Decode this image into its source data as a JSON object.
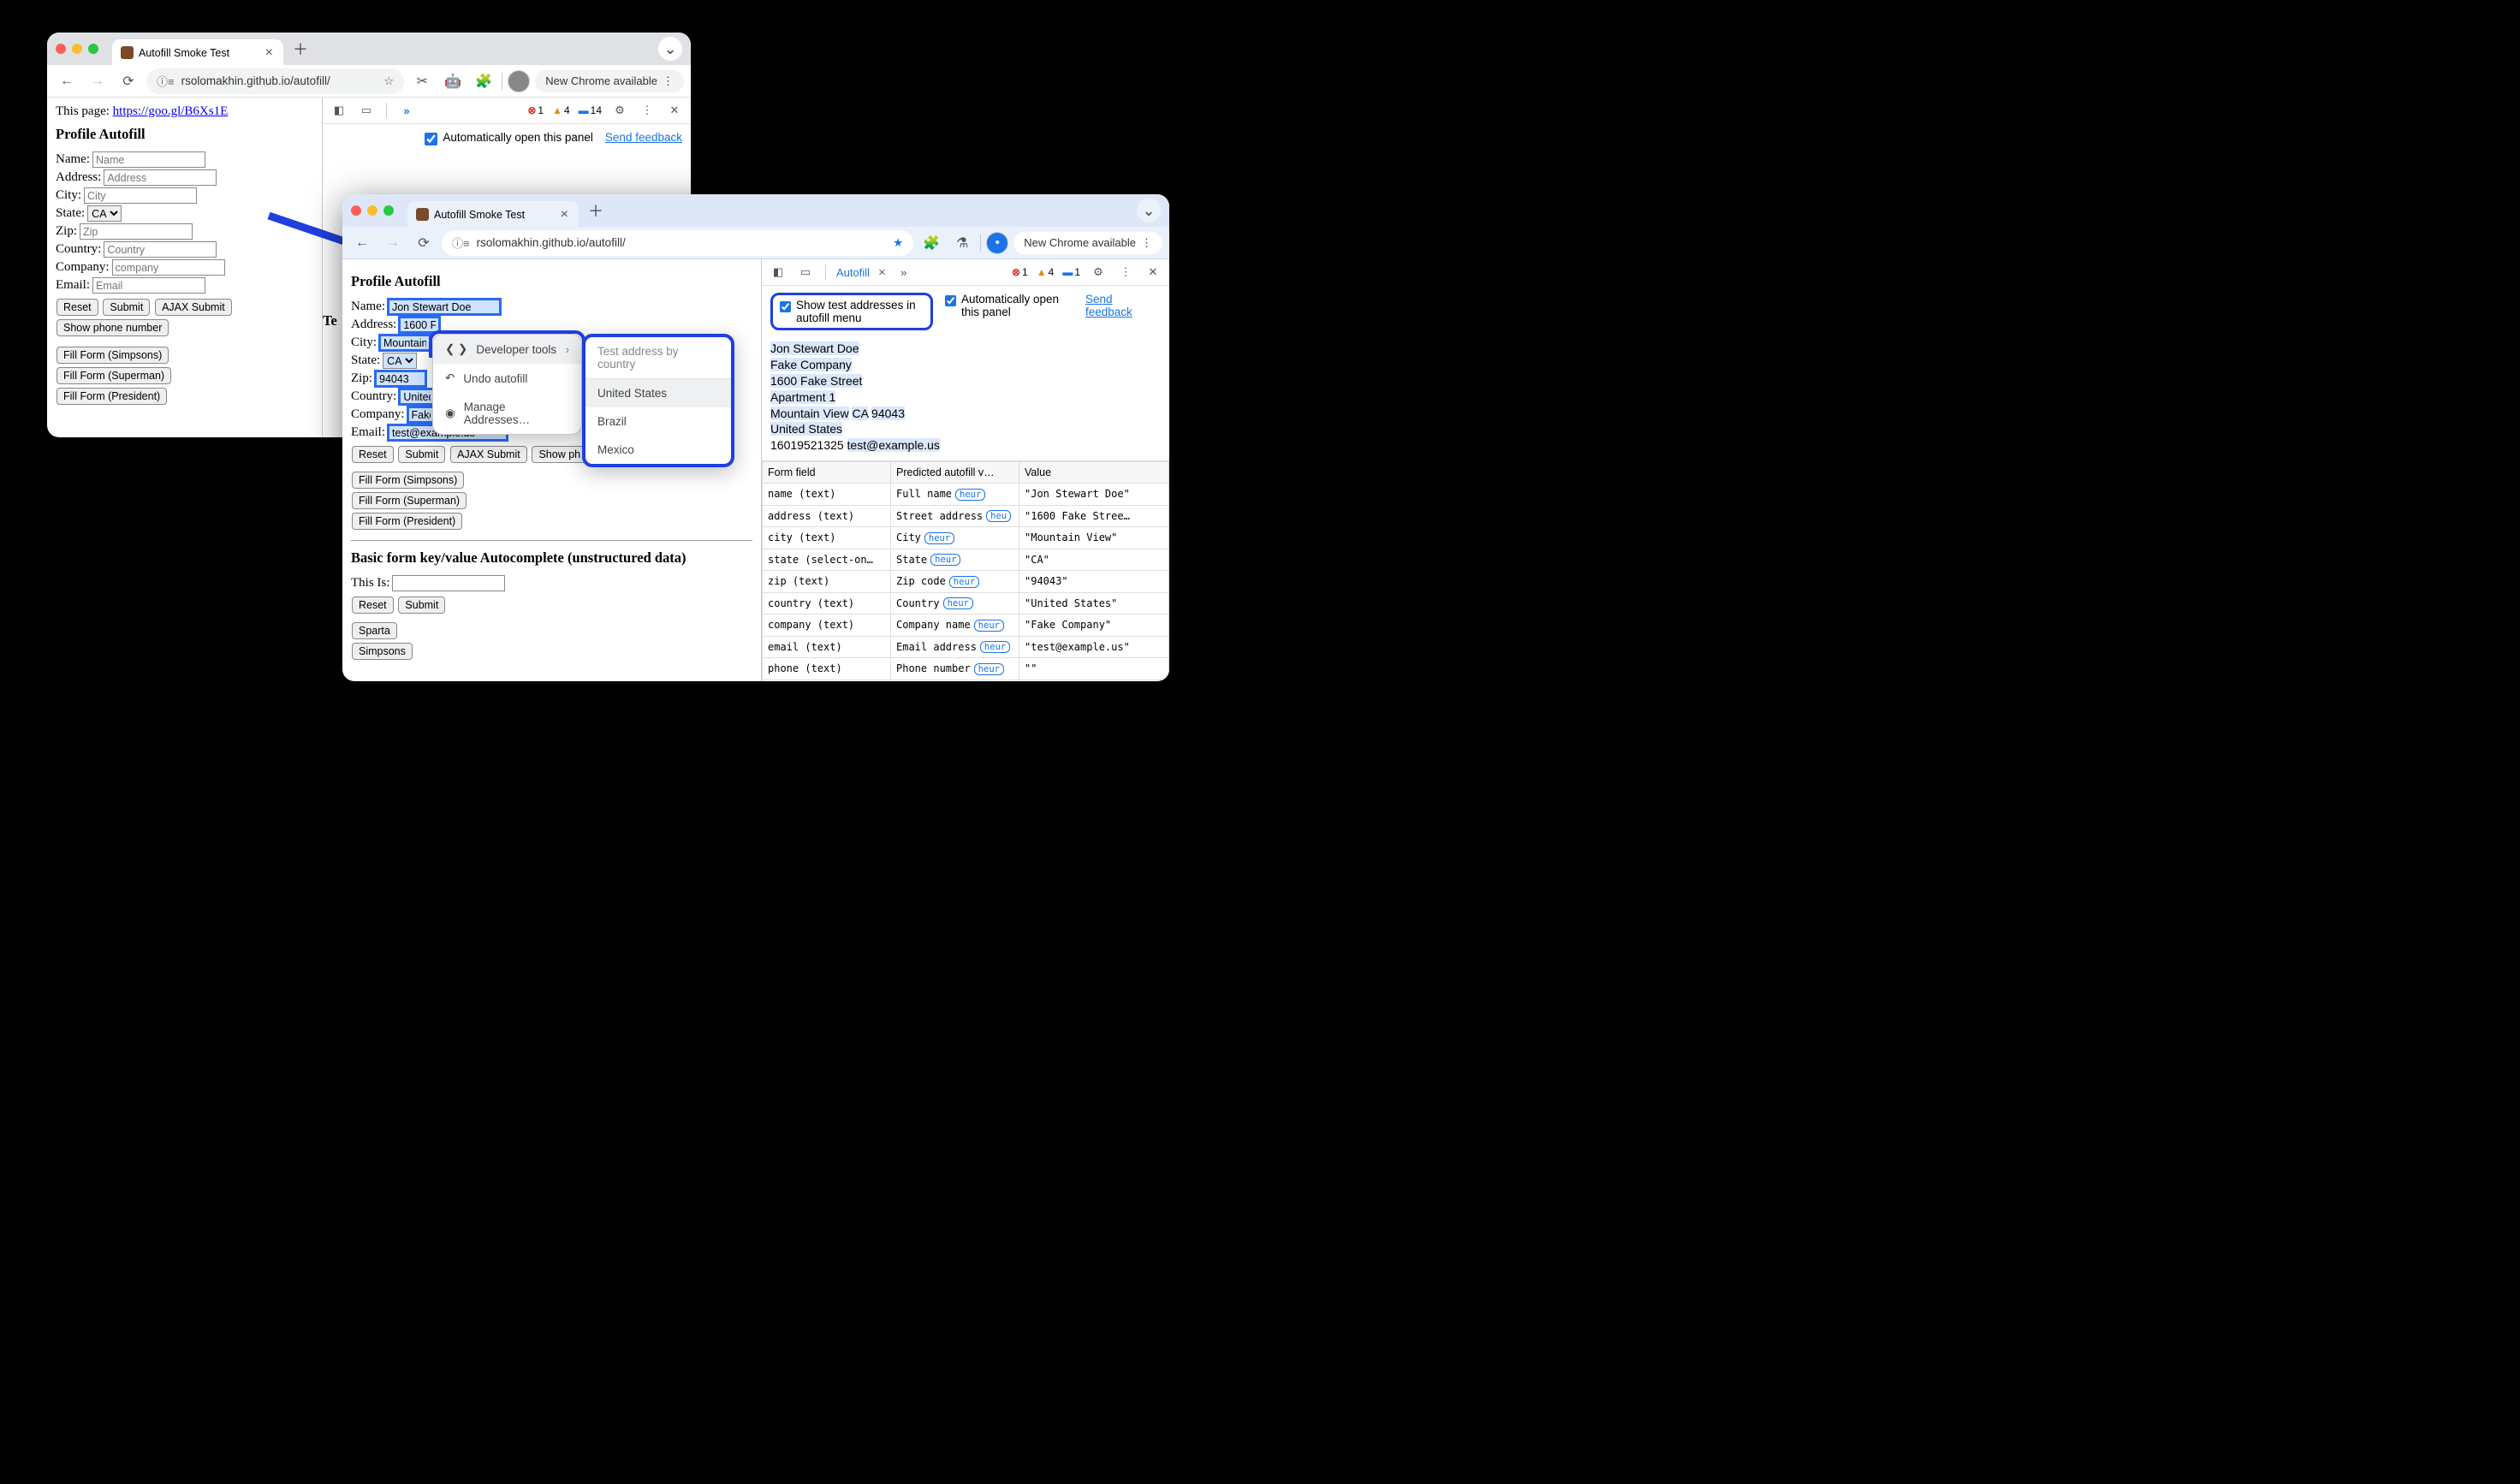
{
  "window1": {
    "tab_title": "Autofill Smoke Test",
    "url": "rsolomakhin.github.io/autofill/",
    "new_chrome": "New Chrome available",
    "page_prefix": "This page: ",
    "page_link": "https://goo.gl/B6Xs1E",
    "heading": "Profile Autofill",
    "labels": {
      "name": "Name:",
      "address": "Address:",
      "city": "City:",
      "state": "State:",
      "zip": "Zip:",
      "country": "Country:",
      "company": "Company:",
      "email": "Email:"
    },
    "placeholders": {
      "name": "Name",
      "address": "Address",
      "city": "City",
      "zip": "Zip",
      "country": "Country",
      "company": "company",
      "email": "Email"
    },
    "state_value": "CA",
    "buttons": {
      "reset": "Reset",
      "submit": "Submit",
      "ajax": "AJAX Submit",
      "show_phone": "Show phone number",
      "ff_simpsons": "Fill Form (Simpsons)",
      "ff_superman": "Fill Form (Superman)",
      "ff_president": "Fill Form (President)"
    },
    "devtools": {
      "errors": "1",
      "warnings": "4",
      "messages": "14",
      "auto_open": "Automatically open this panel",
      "send_feedback": "Send feedback",
      "tab_trunc": "Te"
    }
  },
  "window2": {
    "tab_title": "Autofill Smoke Test",
    "url": "rsolomakhin.github.io/autofill/",
    "new_chrome": "New Chrome available",
    "heading": "Profile Autofill",
    "labels": {
      "name": "Name:",
      "address": "Address:",
      "city": "City:",
      "state": "State:",
      "zip": "Zip:",
      "country": "Country:",
      "company": "Company:",
      "email": "Email:"
    },
    "values": {
      "name": "Jon Stewart Doe",
      "address": "1600 F",
      "city": "Mountain",
      "state": "CA",
      "zip": "94043",
      "country": "United",
      "company": "Fake",
      "email": "test@example.us"
    },
    "buttons": {
      "reset": "Reset",
      "submit": "Submit",
      "ajax": "AJAX Submit",
      "show_phone": "Show ph",
      "ff_simpsons": "Fill Form (Simpsons)",
      "ff_superman": "Fill Form (Superman)",
      "ff_president": "Fill Form (President)"
    },
    "heading2": "Basic form key/value Autocomplete (unstructured data)",
    "this_is": "This Is:",
    "buttons2": {
      "reset": "Reset",
      "submit": "Submit",
      "sparta": "Sparta",
      "simpsons": "Simpsons"
    },
    "autofill_menu": {
      "dev_tools": "Developer tools",
      "undo": "Undo autofill",
      "manage": "Manage Addresses…"
    },
    "country_menu": {
      "header": "Test address by country",
      "items": [
        "United States",
        "Brazil",
        "Mexico"
      ]
    },
    "devtools": {
      "panel": "Autofill",
      "errors": "1",
      "warnings": "4",
      "messages": "1",
      "show_test": "Show test addresses in autofill menu",
      "auto_open": "Automatically open this panel",
      "send_feedback": "Send feedback",
      "address_lines": [
        "Jon Stewart Doe",
        "Fake Company",
        "1600 Fake Street",
        "Apartment 1",
        "Mountain View",
        "CA",
        "94043",
        "United States",
        "16019521325",
        "test@example.us"
      ],
      "table": {
        "headers": [
          "Form field",
          "Predicted autofill v…",
          "Value"
        ],
        "rows": [
          {
            "field": "name (text)",
            "pred": "Full name",
            "heur": "heur",
            "value": "\"Jon Stewart Doe\""
          },
          {
            "field": "address (text)",
            "pred": "Street address",
            "heur": "heu",
            "value": "\"1600 Fake Stree…"
          },
          {
            "field": "city (text)",
            "pred": "City",
            "heur": "heur",
            "value": "\"Mountain View\""
          },
          {
            "field": "state (select-on…",
            "pred": "State",
            "heur": "heur",
            "value": "\"CA\""
          },
          {
            "field": "zip (text)",
            "pred": "Zip code",
            "heur": "heur",
            "value": "\"94043\""
          },
          {
            "field": "country (text)",
            "pred": "Country",
            "heur": "heur",
            "value": "\"United States\""
          },
          {
            "field": "company (text)",
            "pred": "Company name",
            "heur": "heur",
            "value": "\"Fake Company\""
          },
          {
            "field": "email (text)",
            "pred": "Email address",
            "heur": "heur",
            "value": "\"test@example.us\""
          },
          {
            "field": "phone (text)",
            "pred": "Phone number",
            "heur": "heur",
            "value": "\"\""
          }
        ]
      }
    }
  }
}
